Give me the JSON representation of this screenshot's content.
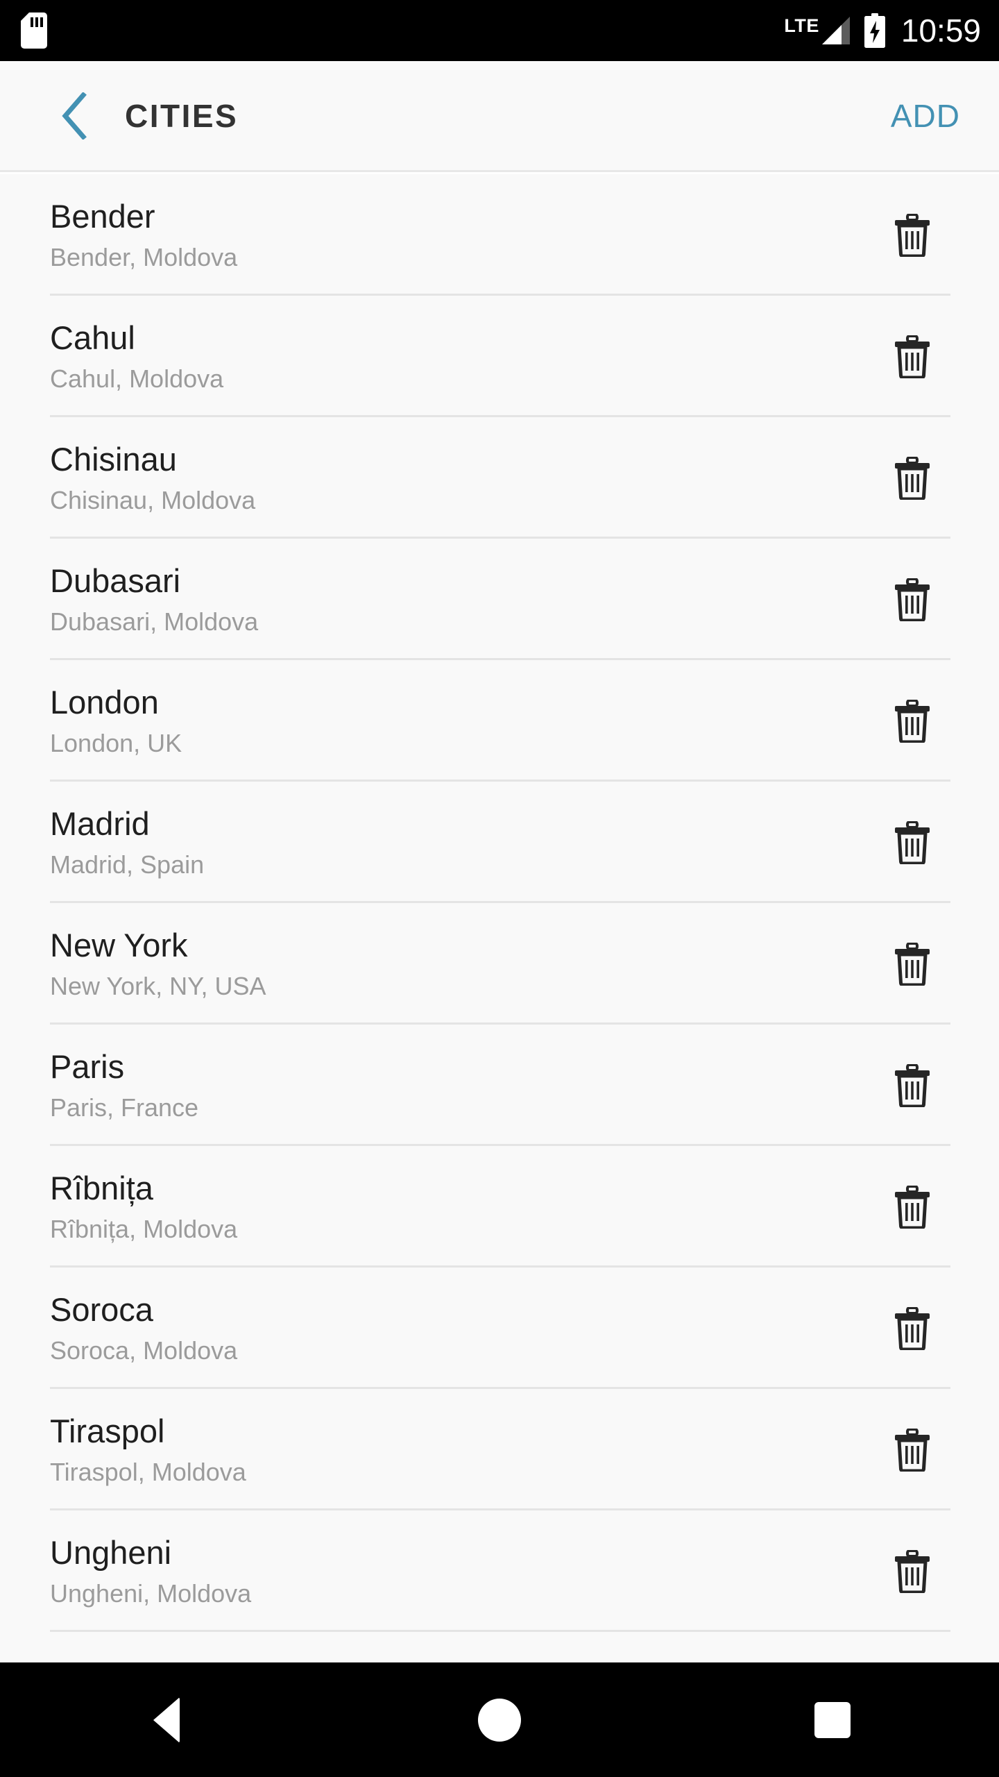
{
  "status_bar": {
    "sd_card_icon": "sd-card-icon",
    "network_label": "LTE",
    "signal_icon": "signal-bars-icon",
    "battery_icon": "battery-charging-icon",
    "time": "10:59",
    "background_color": "#000000"
  },
  "app_bar": {
    "back_icon": "chevron-left-icon",
    "title": "CITIES",
    "action_label": "ADD",
    "accent_color": "#4391B3",
    "title_color": "#333333",
    "background_color": "#F9F9F9"
  },
  "list": {
    "delete_icon": "trash-icon",
    "title_color": "#1f1f1f",
    "subtitle_color": "#9b9b9b",
    "divider_color": "#E4E4E4",
    "items": [
      {
        "name": "Bender",
        "location": "Bender, Moldova"
      },
      {
        "name": "Cahul",
        "location": "Cahul, Moldova"
      },
      {
        "name": "Chisinau",
        "location": "Chisinau, Moldova"
      },
      {
        "name": "Dubasari",
        "location": "Dubasari, Moldova"
      },
      {
        "name": "London",
        "location": "London, UK"
      },
      {
        "name": "Madrid",
        "location": "Madrid, Spain"
      },
      {
        "name": "New York",
        "location": "New York, NY, USA"
      },
      {
        "name": "Paris",
        "location": "Paris, France"
      },
      {
        "name": "Rîbnița",
        "location": "Rîbnița, Moldova"
      },
      {
        "name": "Soroca",
        "location": "Soroca, Moldova"
      },
      {
        "name": "Tiraspol",
        "location": "Tiraspol, Moldova"
      },
      {
        "name": "Ungheni",
        "location": "Ungheni, Moldova"
      }
    ]
  },
  "nav_bar": {
    "back_icon": "nav-back-triangle-icon",
    "home_icon": "nav-home-circle-icon",
    "recents_icon": "nav-recents-square-icon",
    "background_color": "#000000"
  }
}
